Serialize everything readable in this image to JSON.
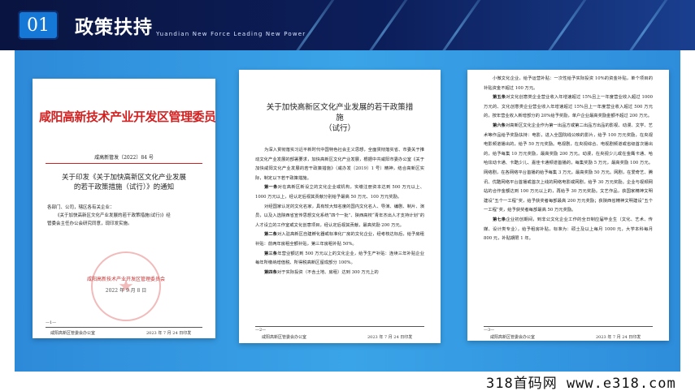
{
  "header": {
    "number": "01",
    "title": "政策扶持",
    "subtitle": "Yuandian New Force Leading New Power"
  },
  "page1": {
    "red_heading": "咸阳高新技术产业开发区管理委员会文件",
    "doc_number": "咸高新管发〔2022〕84 号",
    "title_line1": "关于印发《关于加快高新区文化产业发展",
    "title_line2": "的若干政策措施（试行）》的通知",
    "body_line1": "各部门、公司，辖区各有关企业：",
    "body_line2": "《关于加快高新区文化产业发展的若干政策措施(试行)》经",
    "body_line3": "管委会主任办公会研究同意，现印发实施。",
    "seal_sign": "咸阳高新技术产业开发区管理委员会",
    "date": "2022 年 9 月 8 日",
    "page_number": "—1—",
    "footer_left": "咸阳高新区管委会办公室",
    "footer_right": "2023 年 7 月 24 日印发"
  },
  "page2": {
    "title_line1": "关于加快高新区文化产业发展的若干政策措",
    "title_line2": "施",
    "title_line3": "（试行）",
    "para1": "为深入贯彻落实习近平新时代中国特色社会主义思想，全面贯彻落实省、市委关于推动文化产业发展的部署要求，加快高新区文化产业发展，根据中共咸阳市委办公室《关于加快咸阳文化产业发展的若干政策措施》（咸办发〔2019〕1 号）精神，结合高新区实际，制定以下若干政策措施。",
    "para2_label": "第一条",
    "para2": "对在高新区新设立的文化企业或机构，实缴注册资本达到 500 万元以上、1000 万元以上，经认定后视其贡献分别给予最高 50 万元、100 万元奖励。",
    "para3": "对经国家认定的文化名家，具有较大知名度的国内文化名人、导演、编剧、制片、演员，以及入选陕西省宣传思想文化系统“四个一批”、陕西高校“青年杰出人才支持计划”的人才设立的工作室或文化创意项目，经认定后视其贡献，最高奖励 200 万元。",
    "para4_label": "第二条",
    "para4": "对入驻高新区自建孵化器或标准化厂房的文化企业，经考核达标后，给予房租补贴：前两年房租全额补贴，第三年房租补贴 50%。",
    "para5_label": "第三条",
    "para5": "年营业额达到 500 万元以上的文化企业，给予生产补贴：连续三年补贴企业每年所缴纳增值税、所得税高新区留成部分 100%。",
    "para6_label": "第四条",
    "para6": "对于实际投资（不含土地、房租）达到 300 万元上的",
    "page_number": "—2—",
    "footer_left": "咸阳高新区管委会办公室",
    "footer_right": "2023 年 7 月 24 日印发"
  },
  "page3": {
    "para1": "小微文化企业，给予运营补贴：一次性给予实际投资 10%的资金补贴，单个项目的补贴资金不超过 100 万元。",
    "para2_label": "第五条",
    "para2": "对文化创意类企业营业收入年增速超过 15%且上一年度营业收入超过 1000 万元的、文化创意类企业营业收入年增速超过 15%且上一年度营业收入超过 500 万元的，按年营业收入新增部分的 20%给予奖励，单户企业最高奖励金额不超过 200 万元。",
    "para3_label": "第六条",
    "para3": "对高新区文化企业作为第一出品方或第二出品方出品的影视、动漫、文学、艺术等作品给予奖励扶持：电影，进入全国院线公映的影片，给予 100 万元奖励，在央视电影频道播出的，给予 50 万元奖励。电视剧，在央视综合、电视剧频道或省级首次播出的，给予每集 10 万元奖励，最高奖励 200 万元。动漫，在央视少儿或在金鹰卡通、哈哈炫动卡通、卡酷少儿、嘉佳卡通频道首播的，每集奖励 5 万元，最高奖励 100 万元。网络剧，在各网络平台首播的给予每集 3 万元，最高奖励 50 万元。网剧，在爱奇艺、腾讯、优酷网络平台首播或首次上线的网络电影或网剧，给予 30 万元奖励。企业与视频网站的合作金额达到 100 万元以上的，再给予 30 万元奖励。文艺作品，获国家精神文明建设“五个一工程”奖，给予获奖者每部最高 200 万元奖励；获陕西省精神文明建设“五个一工程”奖，给予获奖者每部最高 50 万元奖励。",
    "para4_label": "第七条",
    "para4": "企业初创期间，到非公文化企业工作的全日制应届毕业生（文化、艺术、传媒、设计类专业），给予租房补贴，标准为：硕士及以上每月 1000 元，大学本科每月 800 元，补贴期限 1 年。",
    "page_number": "—3—",
    "footer_left": "咸阳高新区管委会办公室",
    "footer_right": "2023 年 7 月 24 日印发"
  },
  "watermark": "318首码网  www.e318.com"
}
